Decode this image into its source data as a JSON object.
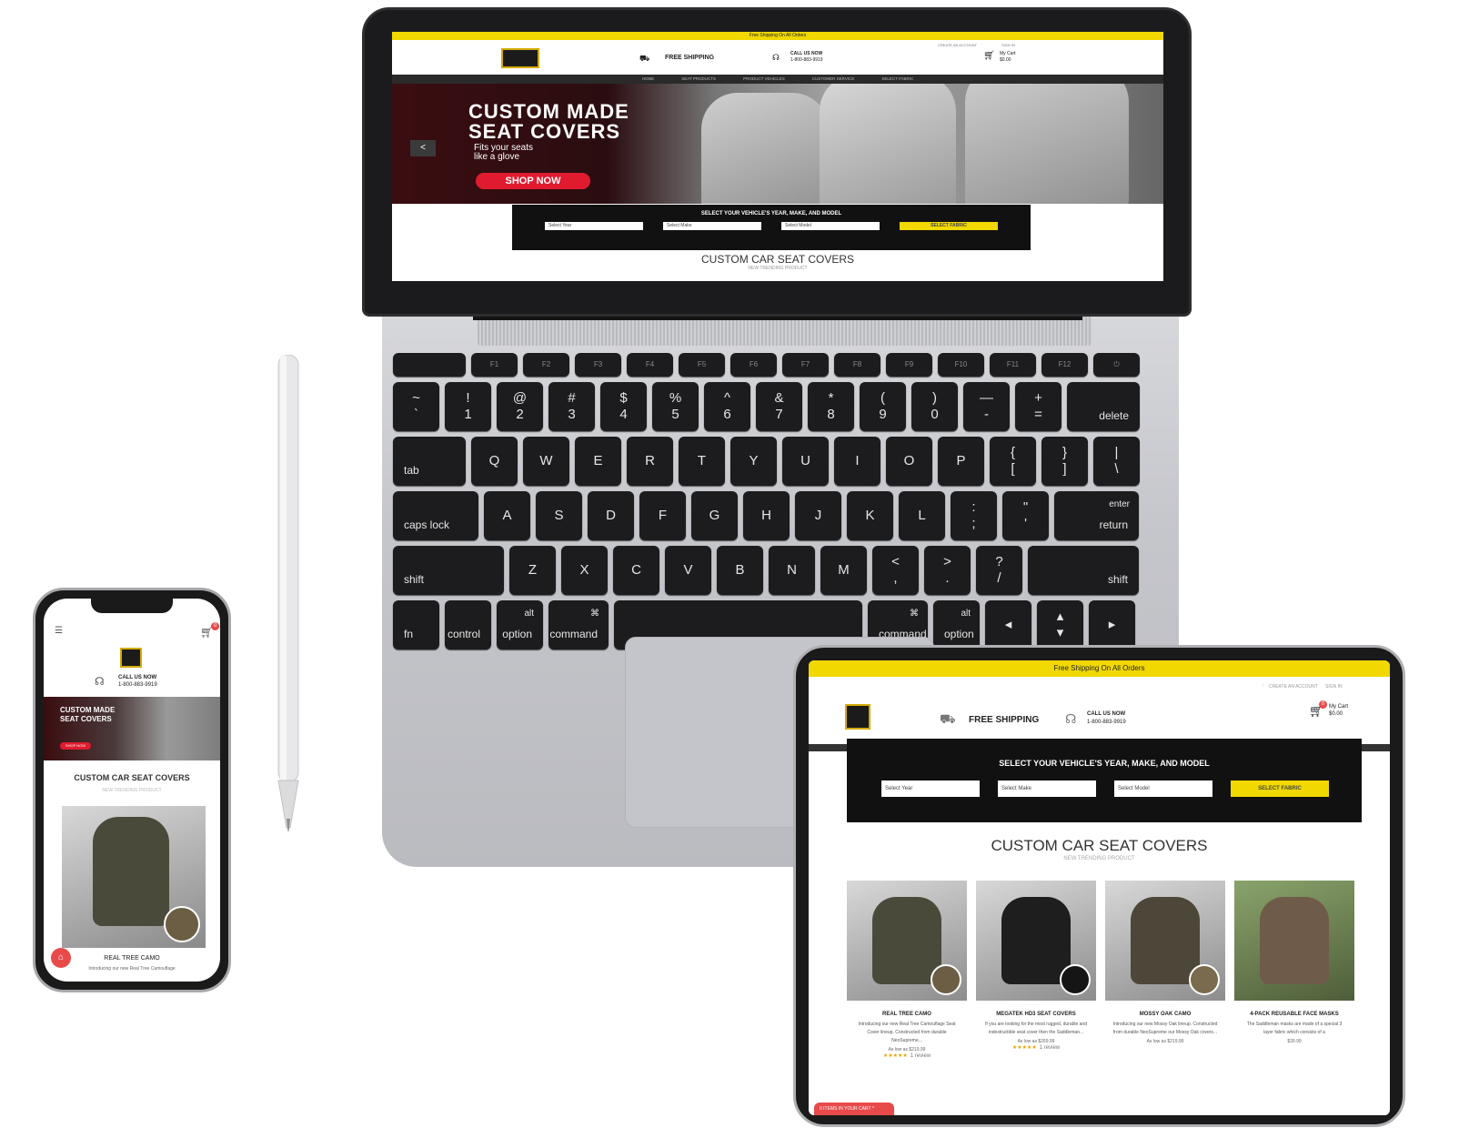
{
  "colors": {
    "brand_yellow": "#f0d800",
    "dark": "#111111",
    "cta_red": "#e01b2f",
    "star": "#e9a400"
  },
  "laptop": {
    "site": {
      "topbar": "Free Shipping On All Orders",
      "free_shipping": "FREE SHIPPING",
      "call_label": "CALL US NOW",
      "call_number": "1-800-883-9919",
      "account_links": "CREATE AN ACCOUNT",
      "sign_in": "SIGN IN",
      "cart_label": "My Cart",
      "cart_total": "$0.00",
      "cart_count": "0",
      "nav": [
        "HOME",
        "SEAT PRODUCTS",
        "PRODUCT VEHICLES",
        "CUSTOMER SERVICE",
        "SELECT FABRIC"
      ],
      "hero_title_1": "CUSTOM MADE",
      "hero_title_2": "SEAT COVERS",
      "hero_sub_1": "Fits your seats",
      "hero_sub_2": "like a glove",
      "hero_cta": "SHOP NOW",
      "hero_prev": "<",
      "finder_title": "SELECT YOUR VEHICLE'S YEAR, MAKE, AND MODEL",
      "select_year": "Select Year",
      "select_make": "Select Make",
      "select_model": "Select Model",
      "select_fabric": "SELECT FABRIC",
      "section_title": "CUSTOM CAR SEAT COVERS",
      "section_sub": "NEW TRENDING PRODUCT"
    },
    "keyboard": {
      "fn_row": [
        "",
        "F1",
        "F2",
        "F3",
        "F4",
        "F5",
        "F6",
        "F7",
        "F8",
        "F9",
        "F10",
        "F11",
        "F12",
        "⏻"
      ],
      "num_top": [
        "~",
        "!",
        "@",
        "#",
        "$",
        "%",
        "^",
        "&",
        "*",
        "(",
        ")",
        "—",
        "+"
      ],
      "num_bottom": [
        "`",
        "1",
        "2",
        "3",
        "4",
        "5",
        "6",
        "7",
        "8",
        "9",
        "0",
        "-",
        "="
      ],
      "delete": "delete",
      "tab": "tab",
      "qwerty": [
        "Q",
        "W",
        "E",
        "R",
        "T",
        "Y",
        "U",
        "I",
        "O",
        "P"
      ],
      "brackets_top": [
        "{",
        "}",
        "|"
      ],
      "brackets_bottom": [
        "[",
        "]",
        "\\"
      ],
      "caps": "caps lock",
      "asdf": [
        "A",
        "S",
        "D",
        "F",
        "G",
        "H",
        "J",
        "K",
        "L"
      ],
      "semi_top": [
        ":",
        "\""
      ],
      "semi_bottom": [
        ";",
        "'"
      ],
      "enter": "enter",
      "return": "return",
      "shift": "shift",
      "zxcv": [
        "Z",
        "X",
        "C",
        "V",
        "B",
        "N",
        "M"
      ],
      "punct_top": [
        "<",
        ">",
        "?"
      ],
      "punct_bottom": [
        ",",
        ".",
        "/"
      ],
      "fn": "fn",
      "control": "control",
      "alt": "alt",
      "option": "option",
      "cmd_symbol": "⌘",
      "command": "command",
      "arrow_left": "◂",
      "arrow_up": "▴",
      "arrow_down": "▾",
      "arrow_right": "▸"
    }
  },
  "phone": {
    "call_label": "CALL US NOW",
    "call_number": "1-800-883-9919",
    "hero_title_1": "CUSTOM MADE",
    "hero_title_2": "SEAT COVERS",
    "hero_cta": "SHOP NOW",
    "section_title": "CUSTOM CAR SEAT COVERS",
    "section_sub": "NEW TRENDING PRODUCT",
    "product_name": "REAL TREE CAMO",
    "product_desc": "Introducing our new Real Tree Camouflage",
    "cart_count": "0"
  },
  "tablet": {
    "topbar": "Free Shipping On All Orders",
    "create_account": "CREATE AN ACCOUNT",
    "sign_in": "SIGN IN",
    "free_shipping": "FREE SHIPPING",
    "call_label": "CALL US NOW",
    "call_number": "1-800-883-9919",
    "cart_label": "My Cart",
    "cart_total": "$0.00",
    "cart_count": "0",
    "finder_title": "SELECT YOUR VEHICLE'S YEAR, MAKE, AND MODEL",
    "select_year": "Select Year",
    "select_make": "Select Make",
    "select_model": "Select Model",
    "select_fabric": "SELECT FABRIC",
    "section_title": "CUSTOM CAR SEAT COVERS",
    "section_sub": "NEW TRENDING PRODUCT",
    "cart_tab": "0 ITEMS IN YOUR CART ^",
    "products": [
      {
        "name": "REAL TREE CAMO",
        "desc": "Introducing our new Real Tree Camouflage Seat Cover lineup. Constructed from durable NeoSupreme...",
        "price": "As low as $219.99",
        "stars": "★★★★★",
        "reviews": "1 review",
        "seat_color": "#4a4a3a",
        "swatch": "#6b5e44"
      },
      {
        "name": "MEGATEK HD3 SEAT COVERS",
        "desc": "If you are looking for the most rugged, durable and indestructible seat cover then the Saddleman...",
        "price": "As low as $269.99",
        "stars": "★★★★★",
        "reviews": "1 review",
        "seat_color": "#1e1e1e",
        "swatch": "#151515"
      },
      {
        "name": "MOSSY OAK CAMO",
        "desc": "Introducing our new Mossy Oak lineup. Constructed from durable NeoSupreme our Mossy Oak covers...",
        "price": "As low as $219.99",
        "stars": "",
        "reviews": "",
        "seat_color": "#4d473a",
        "swatch": "#7a6b4e"
      },
      {
        "name": "4-PACK REUSABLE FACE MASKS",
        "desc": "The Saddleman masks are made of a special 3 layer fabric which consists of a",
        "price": "$39.99",
        "stars": "",
        "reviews": "",
        "seat_color": "#6f5b49",
        "swatch": ""
      }
    ]
  }
}
